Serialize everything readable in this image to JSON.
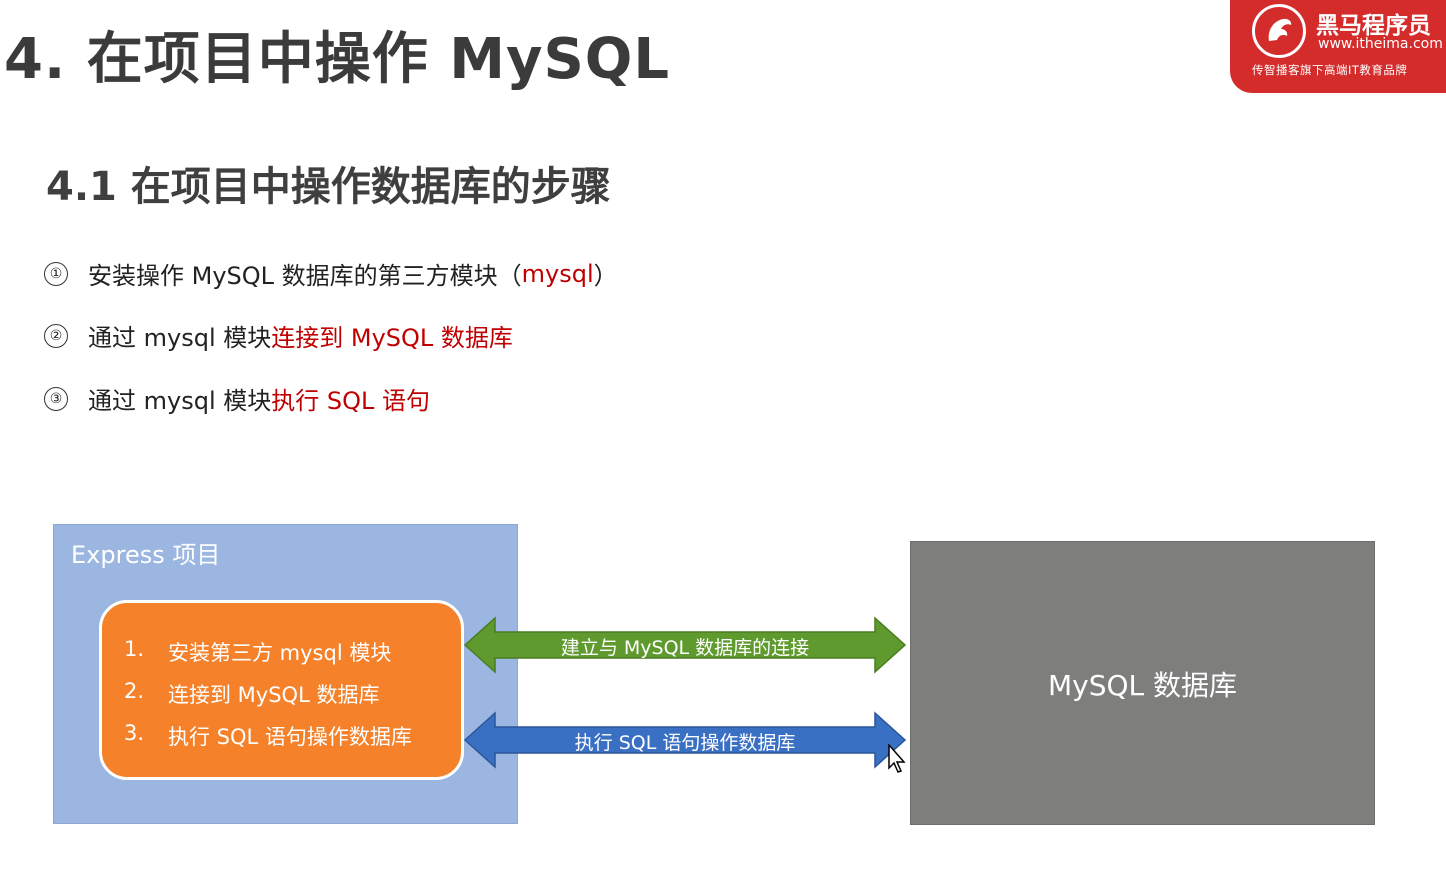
{
  "header": {
    "title": "4. 在项目中操作 MySQL"
  },
  "logo": {
    "name": "黑马程序员",
    "url": "www.itheima.com",
    "slogan": "传智播客旗下高端IT教育品牌"
  },
  "section": {
    "subtitle": "4.1 在项目中操作数据库的步骤"
  },
  "steps": [
    {
      "num": "①",
      "text": "安装操作 MySQL 数据库的第三方模块（",
      "highlight": "mysql",
      "after": "）"
    },
    {
      "num": "②",
      "text": "通过 mysql 模块",
      "highlight": "连接到 MySQL 数据库",
      "after": ""
    },
    {
      "num": "③",
      "text": "通过 mysql 模块",
      "highlight": "执行 SQL 语句",
      "after": ""
    }
  ],
  "diagram": {
    "express_label": "Express 项目",
    "list": [
      {
        "n": "1.",
        "text": "安装第三方 mysql 模块"
      },
      {
        "n": "2.",
        "text": "连接到 MySQL 数据库"
      },
      {
        "n": "3.",
        "text": "执行 SQL 语句操作数据库"
      }
    ],
    "arrow_top_label": "建立与 MySQL 数据库的连接",
    "arrow_bottom_label": "执行 SQL 语句操作数据库",
    "mysql_label": "MySQL 数据库",
    "colors": {
      "express": "#9ab6e1",
      "orange": "#f5822a",
      "arrow_green": "#5f9a2e",
      "arrow_blue": "#3a70c4",
      "mysql": "#7e7f7c"
    }
  }
}
